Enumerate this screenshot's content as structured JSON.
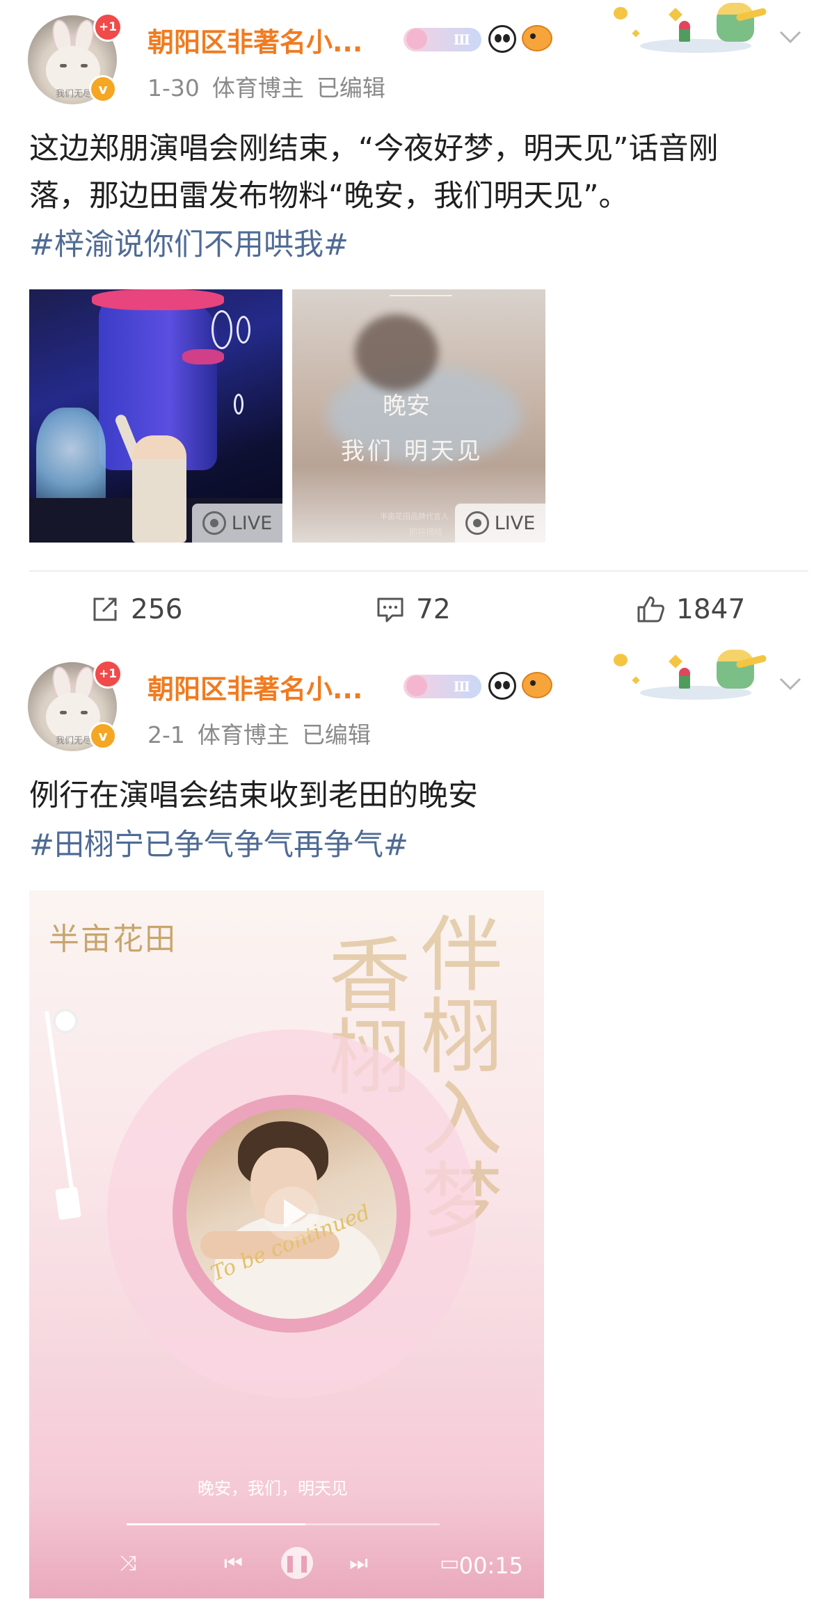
{
  "posts": [
    {
      "avatar_tag": "我们无尽",
      "follow_badge": "+1",
      "verified_badge": "v",
      "username": "朝阳区非著名小...",
      "level_badge": "Ⅲ",
      "meta": {
        "date": "1-30",
        "role": "体育博主",
        "edited": "已编辑"
      },
      "text_line_1": "这边郑朋演唱会刚结束，“今夜好梦，明天见”话音刚",
      "text_line_2": "落，那边田雷发布物料“晚安，我们明天见”。",
      "hashtag": "#梓渝说你们不用哄我#",
      "images": [
        {
          "live_label": "LIVE"
        },
        {
          "live_label": "LIVE",
          "script_1": "晚安",
          "script_2": "我们 明天见",
          "fine_1": "半亩花田品牌代言人",
          "fine_2": "即将揭晓"
        }
      ],
      "actions": {
        "repost_count": "256",
        "comment_count": "72",
        "like_count": "1847"
      }
    },
    {
      "avatar_tag": "我们无尽",
      "follow_badge": "+1",
      "verified_badge": "v",
      "username": "朝阳区非著名小...",
      "level_badge": "Ⅲ",
      "meta": {
        "date": "2-1",
        "role": "体育博主",
        "edited": "已编辑"
      },
      "text_line_1": "例行在演唱会结束收到老田的晚安",
      "hashtag": "#田栩宁已争气争气再争气#",
      "video": {
        "brand": "半亩花田",
        "vertical_1": "伴栩入梦",
        "vertical_2": "香栩",
        "script": "To be continued",
        "lyric": "晚安，我们，明天见",
        "progress": 0.57,
        "time": "00:15"
      }
    }
  ],
  "icons": {
    "repost": "repost-icon",
    "comment": "comment-icon",
    "like": "thumbs-up-icon",
    "more": "chevron-down-icon"
  },
  "colors": {
    "username": "#f07b20",
    "hashtag": "#4f6b95",
    "meta": "#8a8a8a",
    "badge_red": "#f04a4a",
    "verified": "#f5a623"
  }
}
